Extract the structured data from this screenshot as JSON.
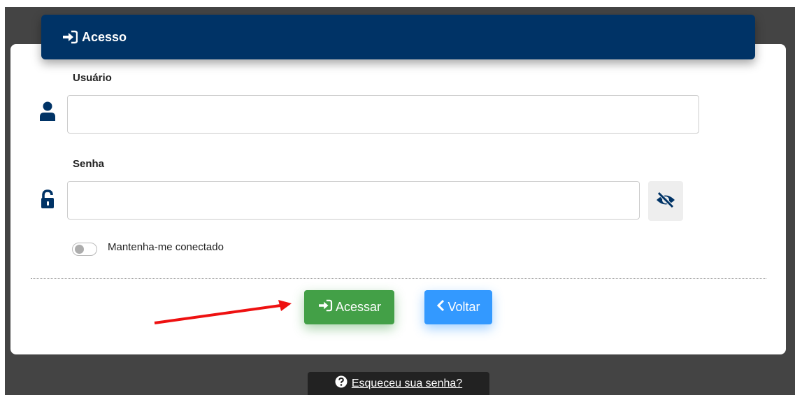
{
  "header": {
    "title": "Acesso",
    "icon": "sign-in-icon"
  },
  "form": {
    "username": {
      "label": "Usuário",
      "value": "",
      "placeholder": "",
      "icon": "user-icon"
    },
    "password": {
      "label": "Senha",
      "value": "",
      "placeholder": "",
      "icon": "unlock-icon",
      "toggle_icon": "eye-slash-icon"
    },
    "remember": {
      "label": "Mantenha-me conectado",
      "checked": false
    }
  },
  "actions": {
    "submit_label": "Acessar",
    "back_label": "Voltar"
  },
  "footer": {
    "forgot_label": "Esqueceu sua senha?",
    "icon": "question-circle-icon"
  },
  "colors": {
    "header_bg": "#003366",
    "submit_bg": "#43a047",
    "back_bg": "#3399ff",
    "annotation_arrow": "#ee1111",
    "backdrop": "#444444"
  }
}
